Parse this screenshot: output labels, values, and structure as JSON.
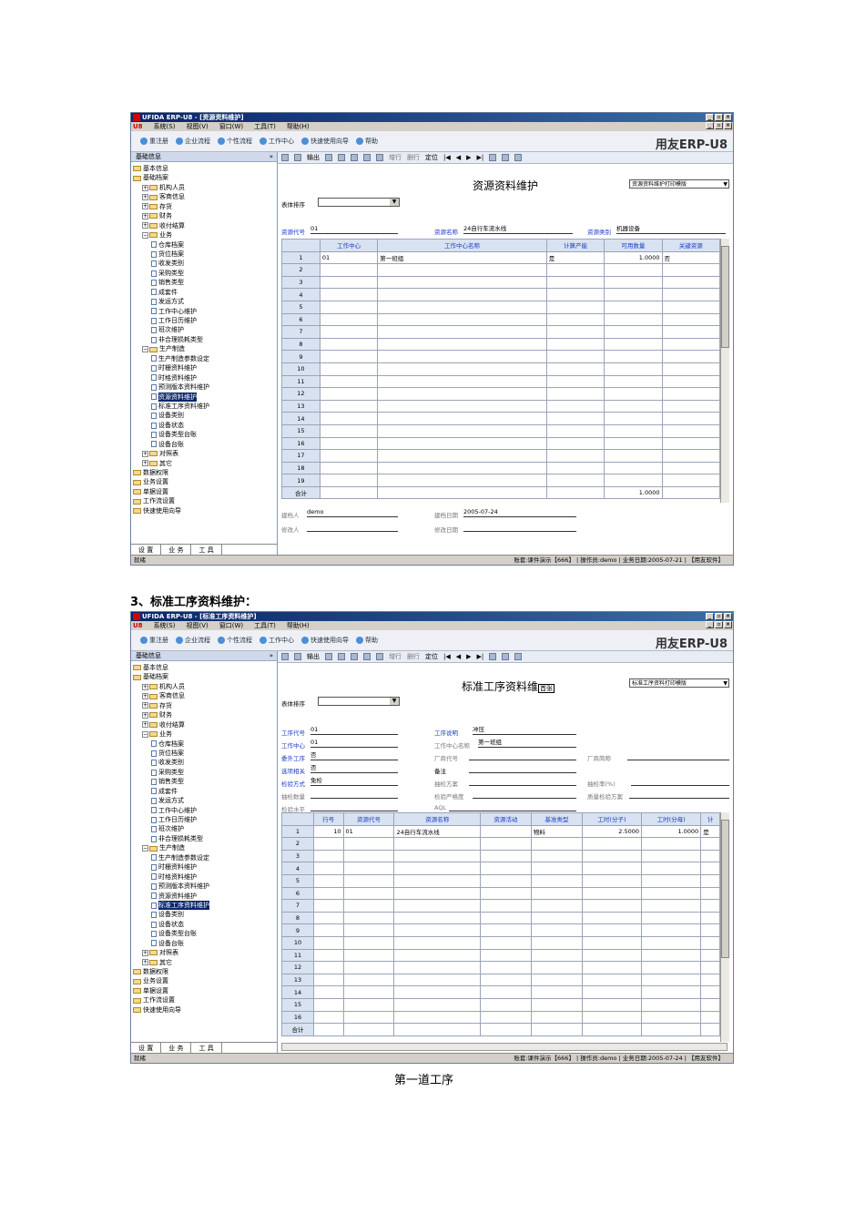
{
  "window1": {
    "title": "UFIDA ERP-U8 - [资源资料维护]",
    "menu": [
      "系统(S)",
      "视图(V)",
      "窗口(W)",
      "工具(T)",
      "帮助(H)"
    ],
    "nav": [
      "重注册",
      "企业流程",
      "个性流程",
      "工作中心",
      "快速使用向导",
      "帮助"
    ],
    "brand": "用友ERP-U8",
    "left_header": "基础信息",
    "tree": [
      {
        "label": "基本信息",
        "level": 0,
        "type": "folder"
      },
      {
        "label": "基础档案",
        "level": 0,
        "type": "folder"
      },
      {
        "label": "机构人员",
        "level": 1,
        "type": "folder"
      },
      {
        "label": "客商信息",
        "level": 1,
        "type": "folder"
      },
      {
        "label": "存货",
        "level": 1,
        "type": "folder"
      },
      {
        "label": "财务",
        "level": 1,
        "type": "folder"
      },
      {
        "label": "收付结算",
        "level": 1,
        "type": "folder"
      },
      {
        "label": "业务",
        "level": 1,
        "type": "folder"
      },
      {
        "label": "仓库档案",
        "level": 2,
        "type": "doc"
      },
      {
        "label": "货位档案",
        "level": 2,
        "type": "doc"
      },
      {
        "label": "收发类别",
        "level": 2,
        "type": "doc"
      },
      {
        "label": "采购类型",
        "level": 2,
        "type": "doc"
      },
      {
        "label": "销售类型",
        "level": 2,
        "type": "doc"
      },
      {
        "label": "成套件",
        "level": 2,
        "type": "doc"
      },
      {
        "label": "发运方式",
        "level": 2,
        "type": "doc"
      },
      {
        "label": "工作中心维护",
        "level": 2,
        "type": "doc"
      },
      {
        "label": "工作日历维护",
        "level": 2,
        "type": "doc"
      },
      {
        "label": "班次维护",
        "level": 2,
        "type": "doc"
      },
      {
        "label": "非合理损耗类型",
        "level": 2,
        "type": "doc"
      },
      {
        "label": "生产制造",
        "level": 1,
        "type": "folder"
      },
      {
        "label": "生产制造参数设定",
        "level": 2,
        "type": "doc"
      },
      {
        "label": "时栅资料维护",
        "level": 2,
        "type": "doc"
      },
      {
        "label": "时格资料维护",
        "level": 2,
        "type": "doc"
      },
      {
        "label": "预测版本资料维护",
        "level": 2,
        "type": "doc"
      },
      {
        "label": "资源资料维护",
        "level": 2,
        "type": "doc",
        "selected": true
      },
      {
        "label": "标准工序资料维护",
        "level": 2,
        "type": "doc"
      },
      {
        "label": "设备类别",
        "level": 2,
        "type": "doc"
      },
      {
        "label": "设备状态",
        "level": 2,
        "type": "doc"
      },
      {
        "label": "设备类型台账",
        "level": 2,
        "type": "doc"
      },
      {
        "label": "设备台账",
        "level": 2,
        "type": "doc"
      },
      {
        "label": "对照表",
        "level": 1,
        "type": "folder"
      },
      {
        "label": "其它",
        "level": 1,
        "type": "folder"
      },
      {
        "label": "数据权限",
        "level": 0,
        "type": "folder"
      },
      {
        "label": "业务设置",
        "level": 0,
        "type": "folder"
      },
      {
        "label": "单据设置",
        "level": 0,
        "type": "folder"
      },
      {
        "label": "工作流设置",
        "level": 0,
        "type": "folder"
      },
      {
        "label": "快速使用向导",
        "level": 0,
        "type": "folder"
      }
    ],
    "tabs": [
      "设 置",
      "业 务",
      "工 具"
    ],
    "toolbar": [
      "输出",
      "增行",
      "删行",
      "定位"
    ],
    "form_title": "资源资料维护",
    "template": "资源资料维护打印模版",
    "sort_label": "表体排序",
    "fields": {
      "code_label": "资源代号",
      "code": "01",
      "name_label": "资源名称",
      "name": "24自行车流水线",
      "type_label": "资源类别",
      "type": "机器设备"
    },
    "columns": [
      "工作中心",
      "工作中心名称",
      "计算产能",
      "可用数量",
      "关键资源"
    ],
    "rows": [
      {
        "n": "1",
        "wc": "01",
        "wcname": "第一班组",
        "cap": "是",
        "qty": "1.0000",
        "key": "否"
      },
      {
        "n": "2"
      },
      {
        "n": "3"
      },
      {
        "n": "4"
      },
      {
        "n": "5"
      },
      {
        "n": "6"
      },
      {
        "n": "7"
      },
      {
        "n": "8"
      },
      {
        "n": "9"
      },
      {
        "n": "10"
      },
      {
        "n": "11"
      },
      {
        "n": "12"
      },
      {
        "n": "13"
      },
      {
        "n": "14"
      },
      {
        "n": "15"
      },
      {
        "n": "16"
      },
      {
        "n": "17"
      },
      {
        "n": "18"
      },
      {
        "n": "19"
      }
    ],
    "total_label": "合计",
    "total_qty": "1.0000",
    "footer": {
      "creator_label": "建档人",
      "creator": "demo",
      "date_label": "建档日期",
      "date": "2005-07-24",
      "modifier_label": "修改人",
      "mdate_label": "修改日期"
    },
    "status_left": "就绪",
    "status_right": "账套:课件演示【666】 | 操作员:demo | 业务日期:2005-07-21 | 【用友软件】"
  },
  "heading": "3、标准工序资料维护：",
  "window2": {
    "title": "UFIDA ERP-U8 - [标准工序资料维护]",
    "form_title": "标准工序资料维",
    "first_btn": "首张",
    "template": "标准工序资料打印模版",
    "fields": {
      "op_code_label": "工序代号",
      "op_code": "01",
      "op_desc_label": "工序说明",
      "op_desc": "冲压",
      "wc_label": "工作中心",
      "wc": "01",
      "wcname_label": "工作中心名称",
      "wcname": "第一班组",
      "outsource_label": "委外工序",
      "outsource": "否",
      "vendor_code_label": "厂商代号",
      "vendor_name_label": "厂商简称",
      "option_label": "选项相关",
      "option": "否",
      "remark_label": "备注",
      "inspect_label": "检验方式",
      "inspect": "免检",
      "sample_plan_label": "抽检方案",
      "sample_rate_label": "抽检率(%)",
      "inspect_qty_label": "抽检数量",
      "strict_label": "检验严格度",
      "quality_plan_label": "质量检验方案",
      "level_label": "检验水平",
      "aql_label": "AQL"
    },
    "columns": [
      "行号",
      "资源代号",
      "资源名称",
      "资源活动",
      "基准类型",
      "工时(分子)",
      "工时(分母)",
      "计"
    ],
    "rows": [
      {
        "n": "1",
        "line": "10",
        "rc": "01",
        "rname": "24自行车流水线",
        "act": "",
        "base": "物料",
        "num": "2.5000",
        "den": "1.0000",
        "calc": "是"
      },
      {
        "n": "2"
      },
      {
        "n": "3"
      },
      {
        "n": "4"
      },
      {
        "n": "5"
      },
      {
        "n": "6"
      },
      {
        "n": "7"
      },
      {
        "n": "8"
      },
      {
        "n": "9"
      },
      {
        "n": "10"
      },
      {
        "n": "11"
      },
      {
        "n": "12"
      },
      {
        "n": "13"
      },
      {
        "n": "14"
      },
      {
        "n": "15"
      },
      {
        "n": "16"
      }
    ],
    "status_right": "账套:课件演示【666】 | 操作员:demo | 业务日期:2005-07-24 | 【用友软件】"
  },
  "caption": "第一道工序"
}
